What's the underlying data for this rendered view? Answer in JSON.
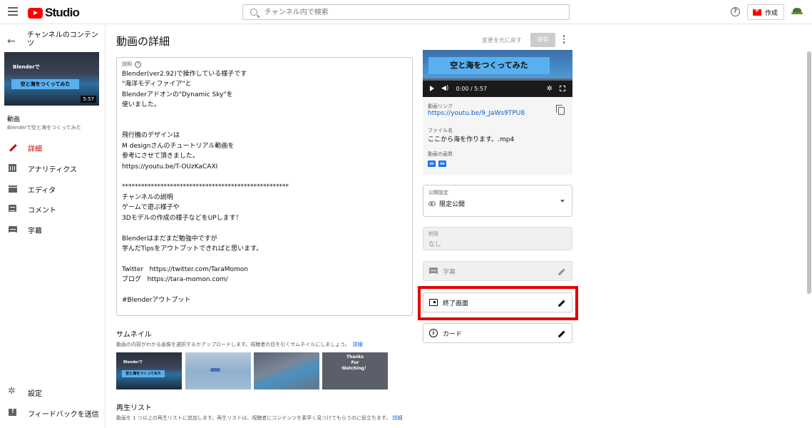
{
  "header": {
    "logo_text": "Studio",
    "search_placeholder": "チャンネル内で検索",
    "help_label": "?",
    "create_label": "作成"
  },
  "sidebar": {
    "channel_title": "チャンネルのコンテンツ",
    "thumb_small_label": "Blenderで",
    "thumb_banner": "空と海をつくってみた",
    "thumb_duration": "5:57",
    "video_label": "動画",
    "video_sub": "Blenderで空と海をつくってみた",
    "nav": [
      {
        "label": "詳細",
        "icon": "pencil-icon",
        "active": true
      },
      {
        "label": "アナリティクス",
        "icon": "analytics-icon"
      },
      {
        "label": "エディタ",
        "icon": "film-icon"
      },
      {
        "label": "コメント",
        "icon": "comment-icon"
      },
      {
        "label": "字幕",
        "icon": "subtitles-icon"
      }
    ],
    "settings_label": "設定",
    "feedback_label": "フィードバックを送信"
  },
  "main": {
    "title": "動画の詳細",
    "revert_label": "変更を元に戻す",
    "save_label": "保存",
    "description_label": "説明",
    "description_text": "Blender(ver2.92)で操作している様子です\n\"海洋モディファイア\"と\nBlenderアドオンの\"Dynamic Sky\"を\n使いました。\n\n\n飛行機のデザインは\nM designさんのチュートリアル動画を\n参考にさせて頂きました。\nhttps://youtu.be/T-OUzKaCAXI\n\n****************************************************\nチャンネルの説明\nゲームで遊ぶ様子や\n3Dモデルの作成の様子などをUPします！\n\nBlenderはまだまだ勉強中ですが\n学んだTipsをアウトプットできればと思います。\n\nTwitter   https://twitter.com/TaraMomon\nブログ   https://tara-momon.com/\n\n#Blenderアウトプット",
    "thumbnail_title": "サムネイル",
    "thumbnail_desc": "動画の内容がわかる画像を選択するかアップロードします。視聴者の目を引くサムネイルにしましょう。",
    "thumbnail_link": "詳細",
    "thumb1_small": "Blenderで",
    "thumb1_banner": "空と海をつくってみた",
    "thumb4_text": "Thanks\nFor\nWatching！",
    "playlist_title": "再生リスト",
    "playlist_desc": "動画を 1 つ以上の再生リストに追加します。再生リストは、視聴者にコンテンツを素早く見つけてもらうのに役立ちます。",
    "playlist_link": "詳細"
  },
  "right": {
    "video_banner": "空と海をつくってみた",
    "video_time": "0:00 / 5:57",
    "video_link_label": "動画リンク",
    "video_link": "https://youtu.be/9_JaWs9TPU8",
    "filename_label": "ファイル名",
    "filename": "ここから海を作ります。.mp4",
    "quality_label": "動画の画質",
    "quality_badges": [
      "SD",
      "HD"
    ],
    "visibility_label": "公開設定",
    "visibility_value": "限定公開",
    "restrictions_label": "制限",
    "restrictions_value": "なし",
    "subtitles_label": "字幕",
    "endscreen_label": "終了画面",
    "cards_label": "カード"
  },
  "colors": {
    "brand_red": "#ff0000",
    "highlight_red": "#e00000",
    "link_blue": "#065fd4"
  }
}
